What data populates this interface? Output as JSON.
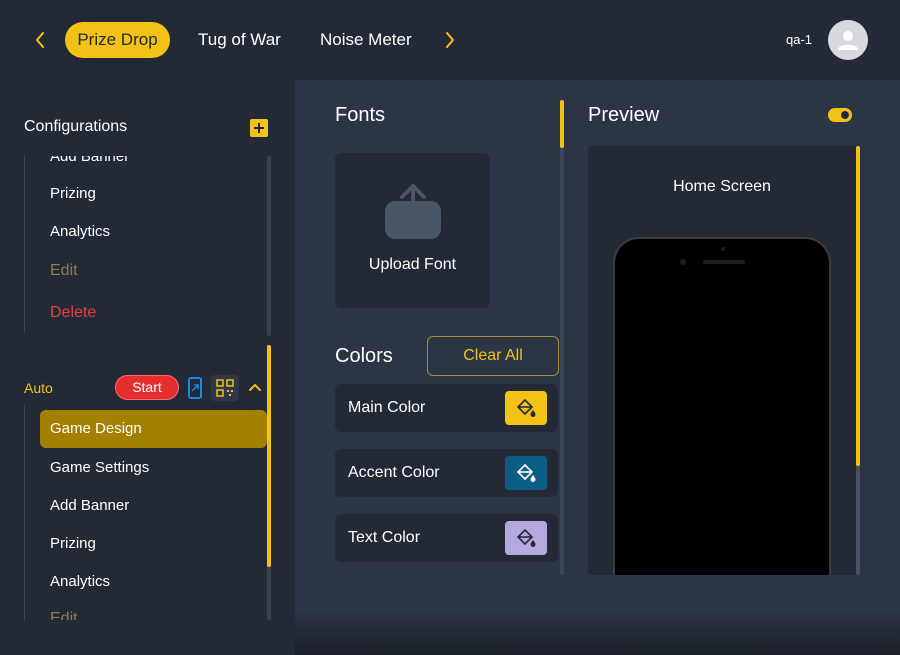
{
  "topbar": {
    "tabs": [
      {
        "label": "Prize Drop",
        "active": true
      },
      {
        "label": "Tug of War",
        "active": false
      },
      {
        "label": "Noise Meter",
        "active": false
      }
    ],
    "username": "qa-1"
  },
  "sidebar": {
    "title": "Configurations",
    "group1_items": [
      {
        "label": "Add Banner"
      },
      {
        "label": "Prizing"
      },
      {
        "label": "Analytics"
      },
      {
        "label": "Edit"
      },
      {
        "label": "Delete"
      }
    ],
    "auto": {
      "label": "Auto",
      "start_label": "Start",
      "active_item": "Game Design",
      "items": [
        {
          "label": "Game Settings"
        },
        {
          "label": "Add Banner"
        },
        {
          "label": "Prizing"
        },
        {
          "label": "Analytics"
        },
        {
          "label": "Edit"
        }
      ]
    }
  },
  "fonts": {
    "heading": "Fonts",
    "upload_label": "Upload Font"
  },
  "colors": {
    "heading": "Colors",
    "clear_label": "Clear All",
    "rows": [
      {
        "label": "Main Color",
        "swatch": "#f2c314",
        "icon": "#232a36"
      },
      {
        "label": "Accent Color",
        "swatch": "#0c5d86",
        "icon": "#ffffff"
      },
      {
        "label": "Text Color",
        "swatch": "#b7a9e0",
        "icon": "#232a36"
      }
    ]
  },
  "preview": {
    "heading": "Preview",
    "screen_label": "Home Screen",
    "toggle_on": true
  },
  "theme": {
    "accent": "#f2c314",
    "danger": "#e2403d"
  }
}
